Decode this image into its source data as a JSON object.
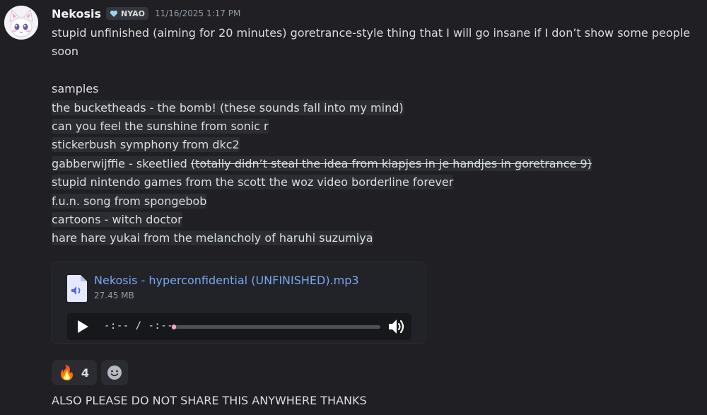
{
  "message": {
    "author": "Nekosis",
    "tag": "NYAO",
    "timestamp": "11/16/2025 1:17 PM",
    "lines": [
      "stupid unfinished (aiming for 20 minutes) goretrance-style thing that I will go insane if I don’t show some people",
      "soon",
      "",
      "samples"
    ],
    "samples": [
      "the bucketheads - the bomb! (these sounds fall into my mind)",
      "can you feel the sunshine from sonic r",
      "stickerbush symphony from dkc2"
    ],
    "gabber_line": {
      "text": "gabberwijffie - skeetlied",
      "struck": "(totally didn’t steal the idea from klapjes in je handjes in goretrance 9)"
    },
    "samples_more": [
      "stupid nintendo games from the scott the woz video borderline forever",
      "f.u.n. song from spongebob",
      "cartoons - witch doctor",
      "hare hare yukai from the melancholy of haruhi suzumiya"
    ]
  },
  "attachment": {
    "file_name": "Nekosis - hyperconfidential (UNFINISHED).mp3",
    "file_size": "27.45 MB",
    "player_time": "-:-- / -:--",
    "progress": 0.0
  },
  "reactions": [
    {
      "emoji": "🔥",
      "icon": "fire-icon",
      "count": "4"
    }
  ],
  "followup": "ALSO PLEASE DO NOT SHARE THIS ANYWHERE THANKS",
  "colors": {
    "background": "#1f1f24",
    "link": "#7aa5f0",
    "progress_accent": "#f6a8c8"
  }
}
